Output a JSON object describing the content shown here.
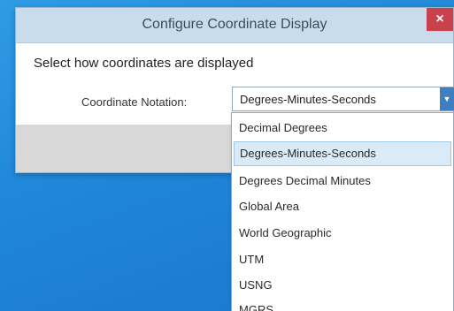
{
  "dialog": {
    "title": "Configure Coordinate Display",
    "close_glyph": "×",
    "prompt": "Select how coordinates are displayed",
    "notation_label": "Coordinate Notation:",
    "notation_value": "Degrees-Minutes-Seconds",
    "dropdown_arrow": "▼"
  },
  "dropdown": {
    "options": [
      {
        "label": "Decimal Degrees",
        "selected": false
      },
      {
        "label": "Degrees-Minutes-Seconds",
        "selected": true
      },
      {
        "label": "Degrees Decimal Minutes",
        "selected": false
      },
      {
        "label": "Global Area",
        "selected": false
      },
      {
        "label": "World Geographic",
        "selected": false
      },
      {
        "label": "UTM",
        "selected": false
      },
      {
        "label": "USNG",
        "selected": false
      },
      {
        "label": "MGRS",
        "selected": false
      }
    ]
  },
  "colors": {
    "titlebar": "#c9dced",
    "close_button": "#c9414a",
    "selected_option": "#dbeaf7",
    "desktop": "#1f86d8"
  }
}
